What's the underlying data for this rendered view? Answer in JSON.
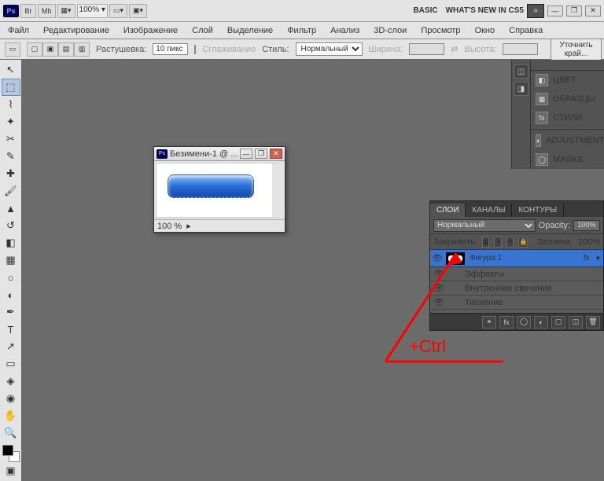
{
  "topbar": {
    "br": "Br",
    "mb": "Mb",
    "zoom": "100%  ▾",
    "basic": "BASIC",
    "news": "WHAT'S NEW IN CS5"
  },
  "menu": [
    "Файл",
    "Редактирование",
    "Изображение",
    "Слой",
    "Выделение",
    "Фильтр",
    "Анализ",
    "3D-слои",
    "Просмотр",
    "Окно",
    "Справка"
  ],
  "options": {
    "feather_label": "Растушевка:",
    "feather_value": "10 пикс",
    "antialias": "Сглаживание",
    "style_label": "Стиль:",
    "style_value": "Нормальный",
    "width_label": "Ширина:",
    "height_label": "Высота:",
    "refine": "Уточнить край..."
  },
  "right_panels": [
    "ЦВЕТ",
    "ОБРАЗЦЫ",
    "СТИЛИ",
    "ADJUSTMENTS",
    "MASKS"
  ],
  "doc": {
    "title": "Безимени-1 @ ...",
    "zoom": "100 %"
  },
  "layers_panel": {
    "tabs": [
      "СЛОИ",
      "КАНАЛЫ",
      "КОНТУРЫ"
    ],
    "blend": "Нормальный",
    "opacity_label": "Opacity:",
    "opacity_value": "100%",
    "lock_label": "Закрепить:",
    "fill_label": "Заливка:",
    "fill_value": "100%",
    "layer_name": "Фигура 1",
    "fx": "fx",
    "effects": "Эффекты",
    "effect1": "Внутреннее свечение",
    "effect2": "Тиснение"
  },
  "annotation": "+Ctrl"
}
